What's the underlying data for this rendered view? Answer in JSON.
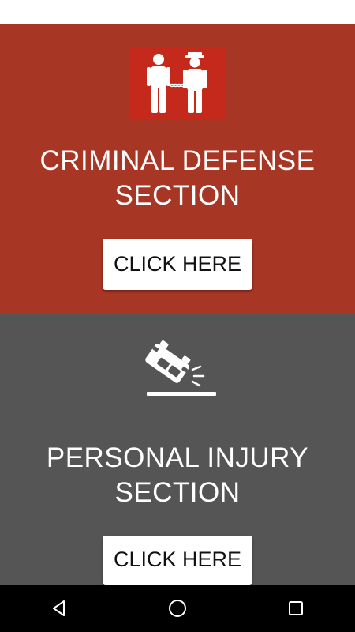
{
  "sections": [
    {
      "id": "criminal-defense",
      "title_lines": [
        "CRIMINAL DEFENSE",
        "SECTION"
      ],
      "button_label": "CLICK HERE",
      "icon": "handcuffed-prisoner-police-icon",
      "background": "#a83624",
      "icon_background": "#c4291c"
    },
    {
      "id": "personal-injury",
      "title_lines": [
        "PERSONAL INJURY",
        "SECTION"
      ],
      "button_label": "CLICK HERE",
      "icon": "car-crash-icon",
      "background": "#555556"
    }
  ],
  "nav": {
    "items": [
      "back-icon",
      "home-icon",
      "recents-icon"
    ]
  }
}
